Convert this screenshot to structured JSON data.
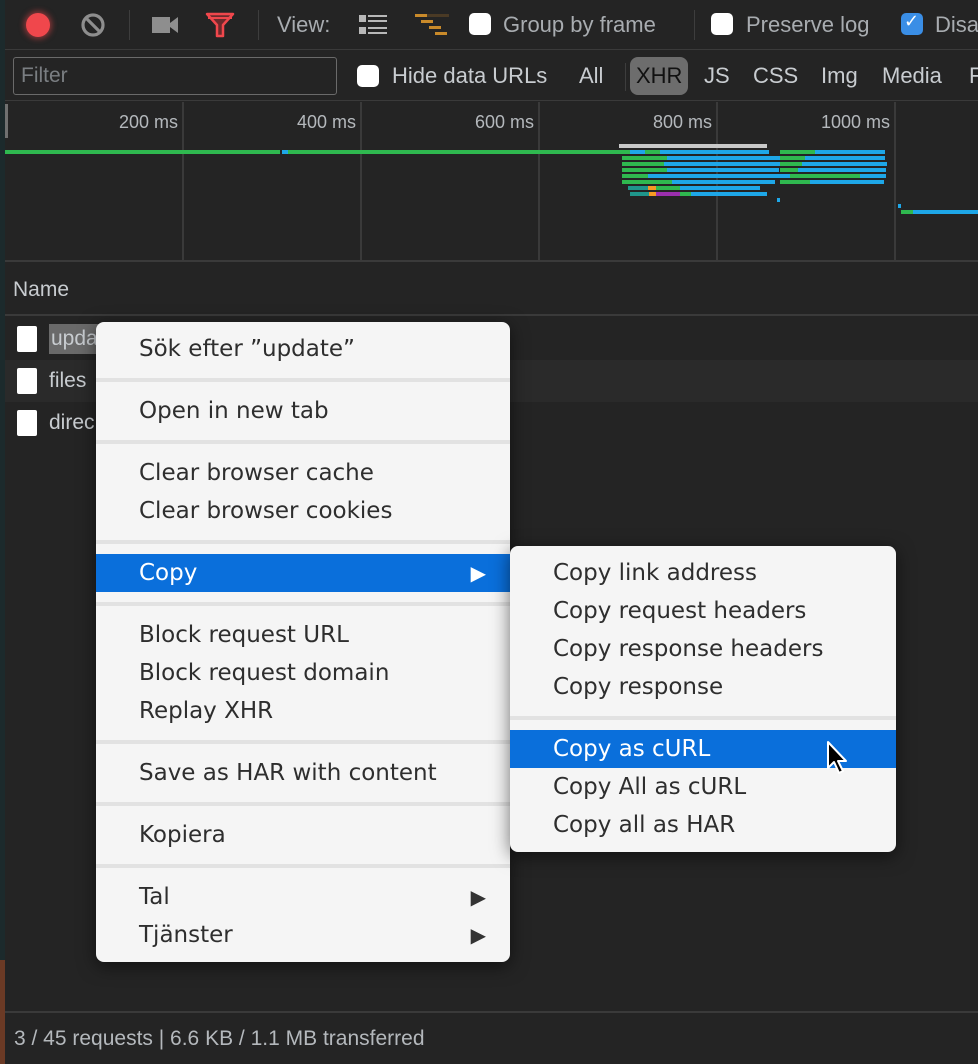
{
  "toolbar": {
    "view_label": "View:",
    "group_by_frame": {
      "label": "Group by frame",
      "checked": false
    },
    "preserve_log": {
      "label": "Preserve log",
      "checked": false
    },
    "disable_cache": {
      "label": "Disa",
      "checked": true
    },
    "icons": [
      "record-icon",
      "clear-icon",
      "screenshot-camera-icon",
      "filter-icon",
      "list-view-icon",
      "waterfall-view-icon"
    ]
  },
  "filterbar": {
    "filter_placeholder": "Filter",
    "filter_value": "",
    "hide_data_urls": {
      "label": "Hide data URLs",
      "checked": false
    },
    "types": [
      {
        "label": "All",
        "active": false
      },
      {
        "label": "XHR",
        "active": true
      },
      {
        "label": "JS",
        "active": false
      },
      {
        "label": "CSS",
        "active": false
      },
      {
        "label": "Img",
        "active": false
      },
      {
        "label": "Media",
        "active": false
      },
      {
        "label": "F",
        "active": false
      }
    ]
  },
  "overview": {
    "ticks": [
      "200 ms",
      "400 ms",
      "600 ms",
      "800 ms",
      "1000 ms"
    ],
    "colors": {
      "waiting": "#2fb84f",
      "download": "#1ea7e8",
      "queue": "#c8c8c8",
      "dns": "#1f968b",
      "connect": "#f59a23",
      "ssl": "#9c2fae"
    }
  },
  "table": {
    "header": "Name",
    "rows": [
      {
        "name": "upda",
        "selected": true
      },
      {
        "name": "files",
        "selected": false
      },
      {
        "name": "direc",
        "selected": false
      }
    ]
  },
  "context_menu": {
    "groups": [
      [
        {
          "label": "Sök efter ”update”"
        }
      ],
      [
        {
          "label": "Open in new tab"
        }
      ],
      [
        {
          "label": "Clear browser cache"
        },
        {
          "label": "Clear browser cookies"
        }
      ],
      [
        {
          "label": "Copy",
          "submenu": true,
          "highlighted": true
        }
      ],
      [
        {
          "label": "Block request URL"
        },
        {
          "label": "Block request domain"
        },
        {
          "label": "Replay XHR"
        }
      ],
      [
        {
          "label": "Save as HAR with content"
        }
      ],
      [
        {
          "label": "Kopiera"
        }
      ],
      [
        {
          "label": "Tal",
          "submenu": true
        },
        {
          "label": "Tjänster",
          "submenu": true
        }
      ]
    ],
    "arrow_glyph": "▶"
  },
  "copy_submenu": {
    "groups": [
      [
        {
          "label": "Copy link address"
        },
        {
          "label": "Copy request headers"
        },
        {
          "label": "Copy response headers"
        },
        {
          "label": "Copy response"
        }
      ],
      [
        {
          "label": "Copy as cURL",
          "highlighted": true
        },
        {
          "label": "Copy All as cURL"
        },
        {
          "label": "Copy all as HAR"
        }
      ]
    ]
  },
  "status": {
    "text": "3 / 45 requests | 6.6 KB / 1.1 MB transferred"
  }
}
